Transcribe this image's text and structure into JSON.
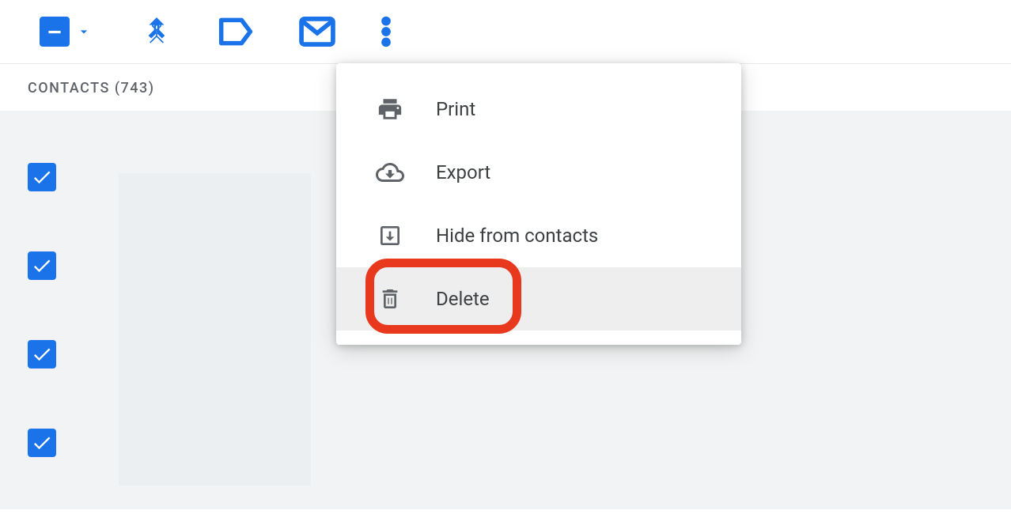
{
  "section": {
    "title": "CONTACTS (743)"
  },
  "menu": {
    "items": [
      {
        "label": "Print",
        "icon": "print-icon"
      },
      {
        "label": "Export",
        "icon": "export-icon"
      },
      {
        "label": "Hide from contacts",
        "icon": "hide-icon"
      },
      {
        "label": "Delete",
        "icon": "delete-icon"
      }
    ]
  }
}
